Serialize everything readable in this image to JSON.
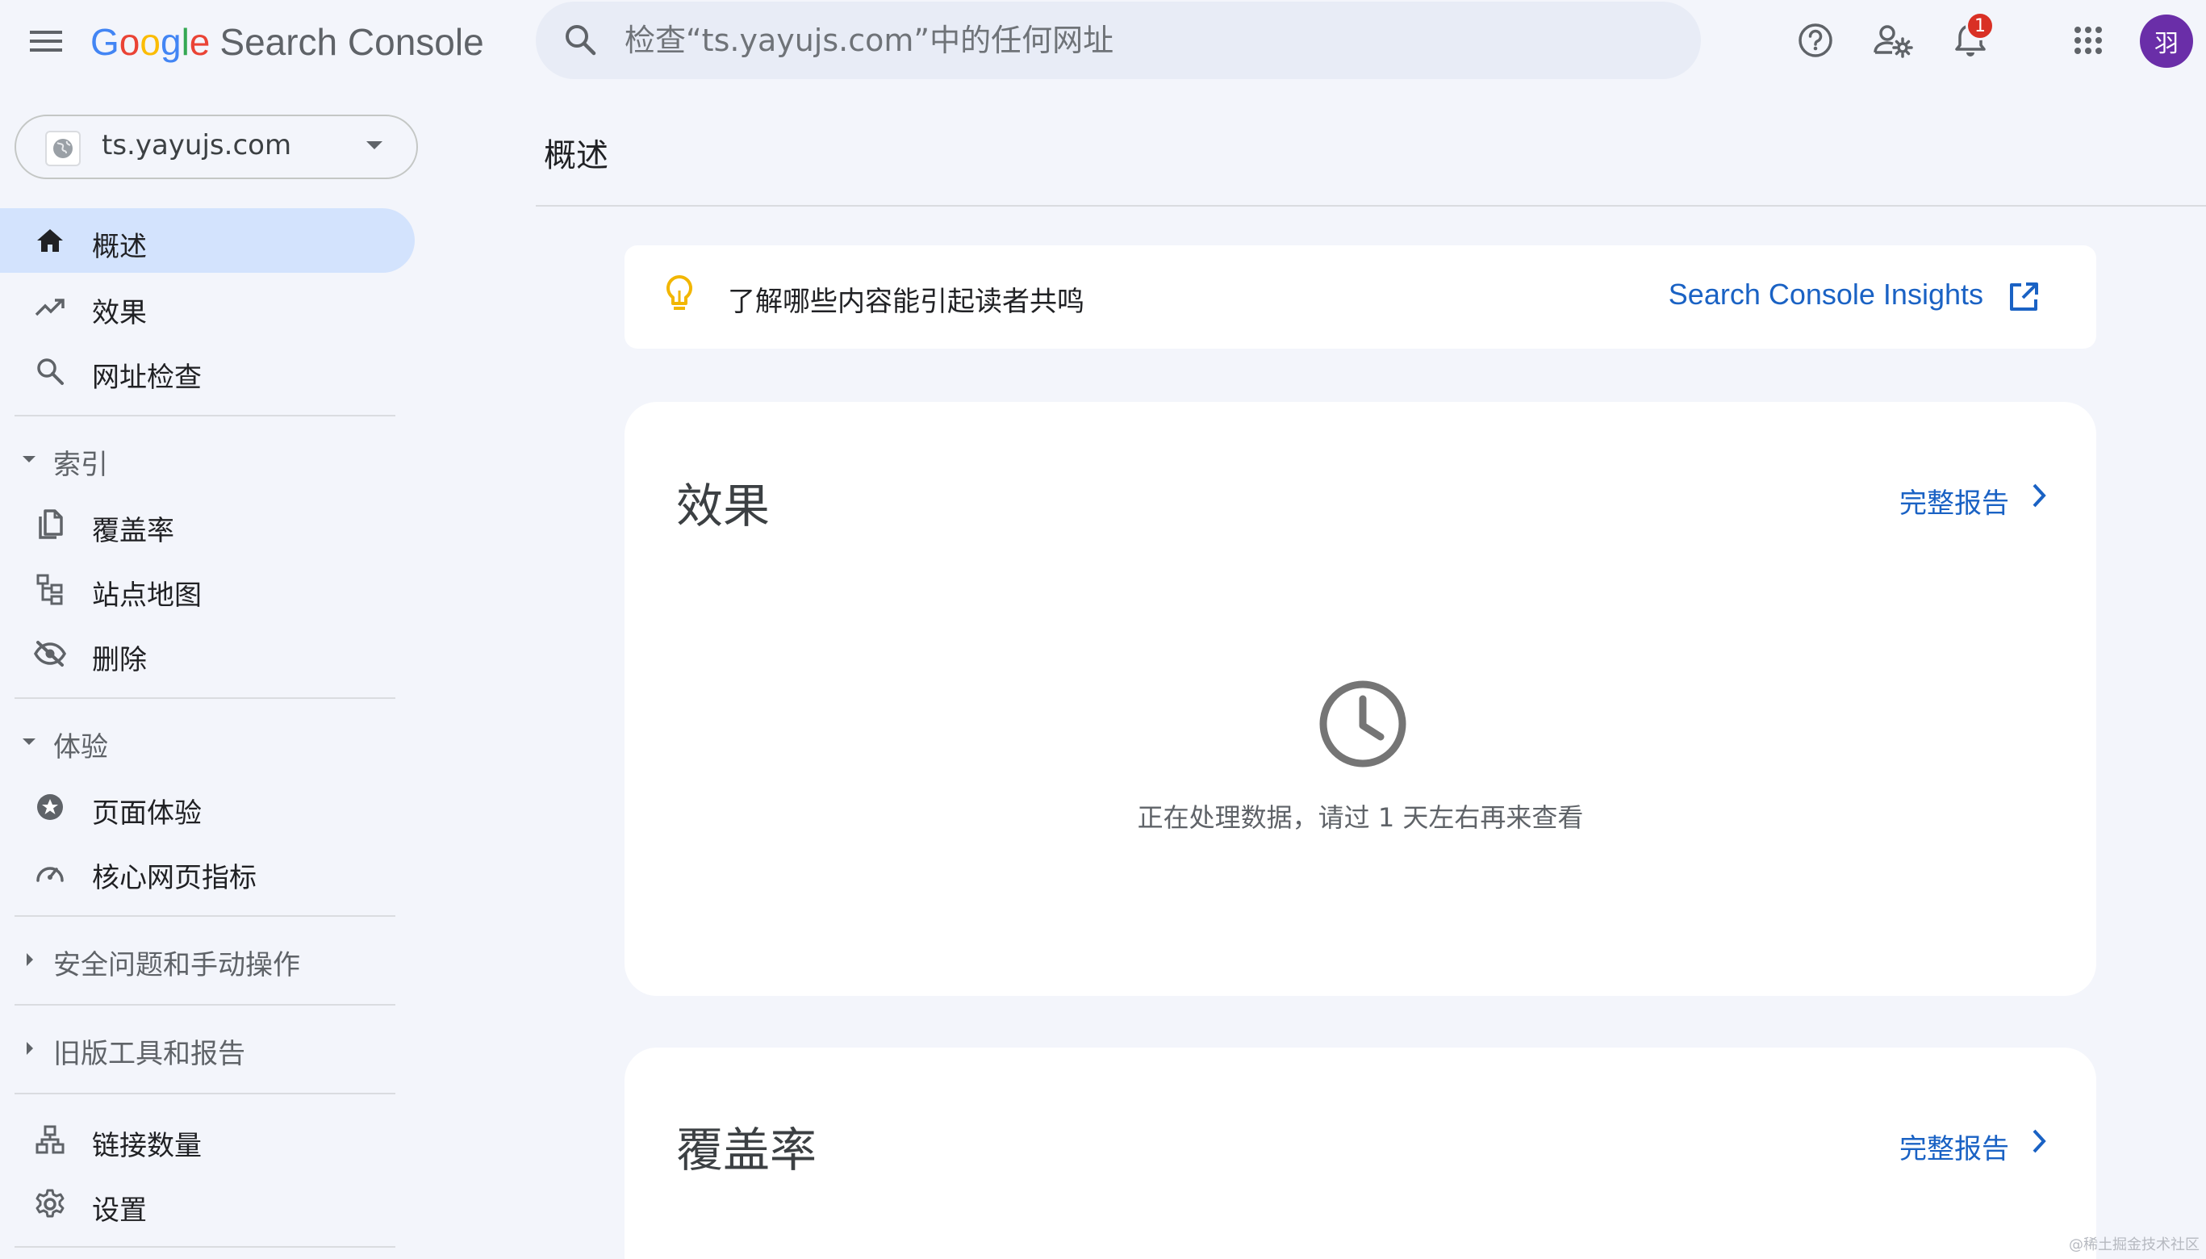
{
  "header": {
    "logo_google": [
      "G",
      "o",
      "o",
      "g",
      "l",
      "e"
    ],
    "logo_colors": [
      "#4285F4",
      "#EA4335",
      "#FBBC05",
      "#4285F4",
      "#34A853",
      "#EA4335"
    ],
    "product_name": "Search Console",
    "search_placeholder": "检查“ts.yayujs.com”中的任何网址",
    "notification_count": "1",
    "avatar_initial": "羽"
  },
  "property": {
    "label": "ts.yayujs.com"
  },
  "sidebar": {
    "top_items": [
      {
        "label": "概述",
        "icon": "home-icon",
        "active": true
      },
      {
        "label": "效果",
        "icon": "trending-up-icon"
      },
      {
        "label": "网址检查",
        "icon": "search-icon"
      }
    ],
    "sections": [
      {
        "label": "索引",
        "expanded": true,
        "items": [
          {
            "label": "覆盖率",
            "icon": "copy-pages-icon"
          },
          {
            "label": "站点地图",
            "icon": "sitemap-icon"
          },
          {
            "label": "删除",
            "icon": "visibility-off-icon"
          }
        ]
      },
      {
        "label": "体验",
        "expanded": true,
        "items": [
          {
            "label": "页面体验",
            "icon": "star-circle-icon"
          },
          {
            "label": "核心网页指标",
            "icon": "speed-gauge-icon"
          }
        ]
      },
      {
        "label": "安全问题和手动操作",
        "expanded": false
      },
      {
        "label": "旧版工具和报告",
        "expanded": false
      }
    ],
    "bottom_items": [
      {
        "label": "链接数量",
        "icon": "links-hierarchy-icon"
      },
      {
        "label": "设置",
        "icon": "gear-icon"
      }
    ]
  },
  "main": {
    "page_title": "概述",
    "insight": {
      "text": "了解哪些内容能引起读者共鸣",
      "link_label": "Search Console Insights"
    },
    "cards": [
      {
        "title": "效果",
        "link_label": "完整报告",
        "message": "正在处理数据，请过 1 天左右再来查看"
      },
      {
        "title": "覆盖率",
        "link_label": "完整报告"
      }
    ]
  },
  "watermark": "@稀土掘金技术社区",
  "colors": {
    "accent": "#1a62c4",
    "active_nav": "#d3e3fd",
    "background": "#f3f5fb",
    "avatar": "#6a2ea8",
    "badge": "#d93025",
    "bulb": "#f2b600"
  }
}
